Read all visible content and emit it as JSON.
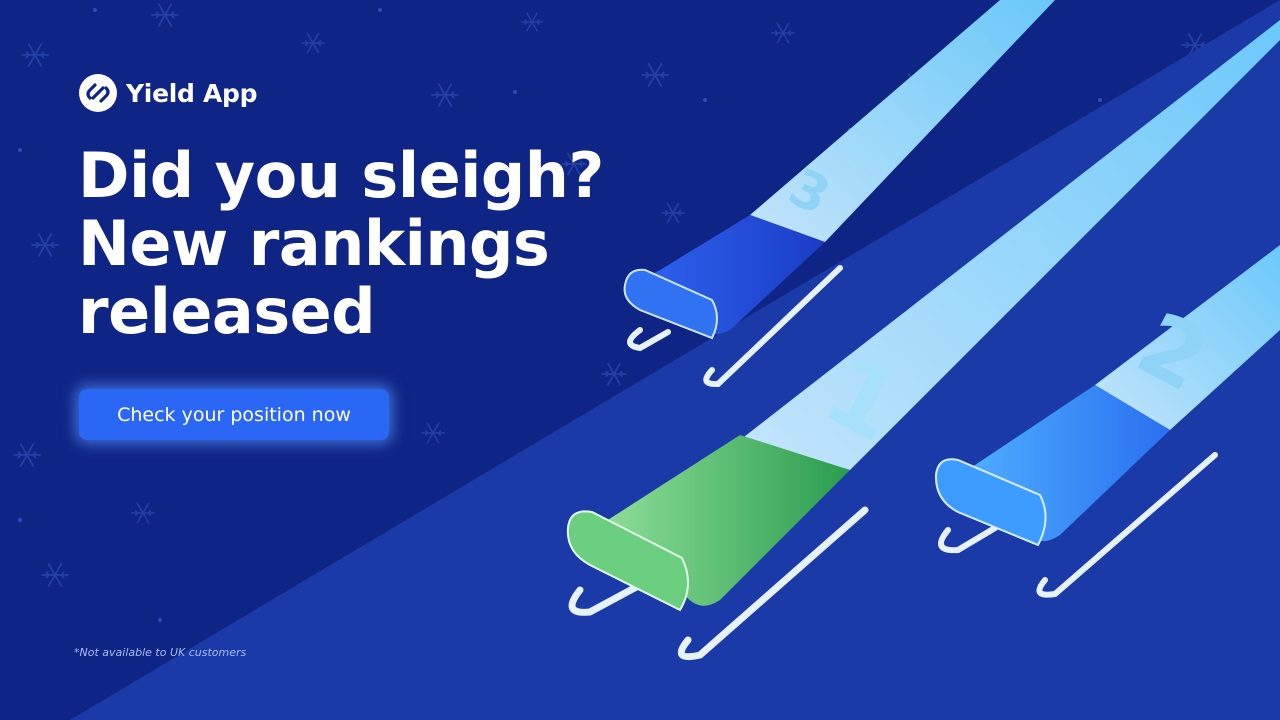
{
  "brand": {
    "name": "Yield App",
    "logo_icon": "yield-app-logo-icon"
  },
  "headline": {
    "line1": "Did you sleigh?",
    "line2": "New rankings",
    "line3": "released"
  },
  "cta": {
    "label": "Check your position now"
  },
  "disclaimer": "*Not available to UK customers",
  "sleds": [
    {
      "rank": "1",
      "color": "#3fae5b"
    },
    {
      "rank": "2",
      "color": "#2f86f0"
    },
    {
      "rank": "3",
      "color": "#1f4ed4"
    }
  ],
  "colors": {
    "background": "#0f2585",
    "lane": "#1a3aa8",
    "cta": "#2a67f5",
    "trail": "#b7e8ff"
  }
}
